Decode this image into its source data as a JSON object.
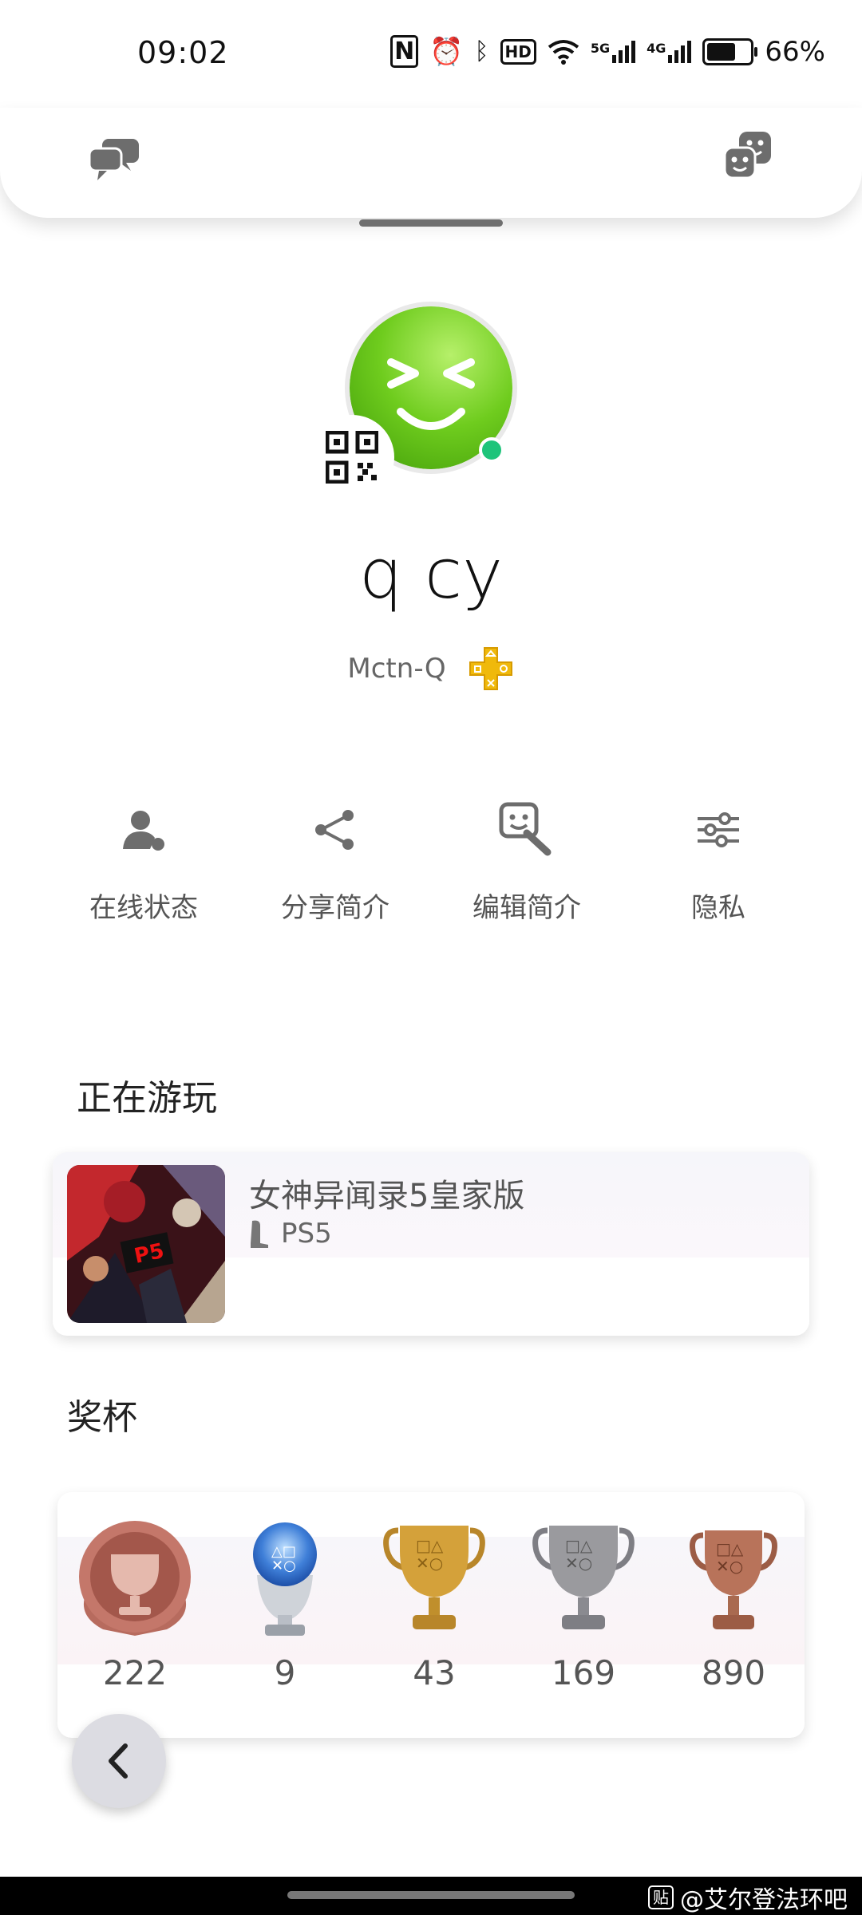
{
  "status_bar": {
    "time": "09:02",
    "hd_badge": "HD",
    "net1": "5G",
    "net2": "4G",
    "battery_text": "66%",
    "battery_level": 0.66
  },
  "header": {
    "left_icon": "chat-bubbles-icon",
    "right_icon": "friends-faces-icon"
  },
  "profile": {
    "name": "q cy",
    "online_id": "Mctn-Q",
    "online_status_color": "#1ec47a",
    "avatar_color": "#7dd321"
  },
  "actions": [
    {
      "label": "在线状态",
      "icon": "person-status-icon"
    },
    {
      "label": "分享简介",
      "icon": "share-icon"
    },
    {
      "label": "编辑简介",
      "icon": "edit-profile-icon"
    },
    {
      "label": "隐私",
      "icon": "sliders-icon"
    }
  ],
  "now_playing": {
    "section_title": "正在游玩",
    "game_title": "女神异闻录5皇家版",
    "platform": "PS5"
  },
  "trophies": {
    "section_title": "奖杯",
    "items": [
      {
        "kind": "level",
        "count": "222",
        "color": "#c4776a"
      },
      {
        "kind": "platinum",
        "count": "9",
        "color": "#4a86d8"
      },
      {
        "kind": "gold",
        "count": "43",
        "color": "#d4a13a"
      },
      {
        "kind": "silver",
        "count": "169",
        "color": "#9a9a9e"
      },
      {
        "kind": "bronze",
        "count": "890",
        "color": "#b8735a"
      }
    ]
  },
  "watermark": {
    "badge": "贴",
    "text": "@艾尔登法环吧"
  }
}
